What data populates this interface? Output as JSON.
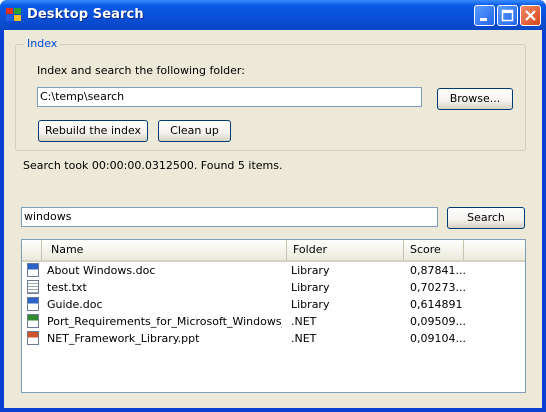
{
  "window": {
    "title": "Desktop Search",
    "controls": [
      "minimize-icon",
      "maximize-icon",
      "close-icon"
    ]
  },
  "index_group": {
    "legend": "Index",
    "instruction": "Index and search the following folder:",
    "folder_value": "C:\\temp\\search",
    "browse_label": "Browse...",
    "rebuild_label": "Rebuild the index",
    "cleanup_label": "Clean up"
  },
  "status": "Search took 00:00:00.0312500. Found 5 items.",
  "search": {
    "query_value": "windows",
    "button_label": "Search"
  },
  "results": {
    "columns": [
      "Name",
      "Folder",
      "Score"
    ],
    "rows": [
      {
        "icon": "word-doc-icon",
        "name": "About Windows.doc",
        "folder": "Library",
        "score": "0,87841..."
      },
      {
        "icon": "text-file-icon",
        "name": "test.txt",
        "folder": "Library",
        "score": "0,70273..."
      },
      {
        "icon": "word-doc-icon",
        "name": "Guide.doc",
        "folder": "Library",
        "score": "0,614891"
      },
      {
        "icon": "excel-file-icon",
        "name": "Port_Requirements_for_Microsoft_Windows_S...",
        "folder": ".NET",
        "score": "0,09509..."
      },
      {
        "icon": "powerpoint-file-icon",
        "name": "NET_Framework_Library.ppt",
        "folder": ".NET",
        "score": "0,09104..."
      }
    ]
  }
}
